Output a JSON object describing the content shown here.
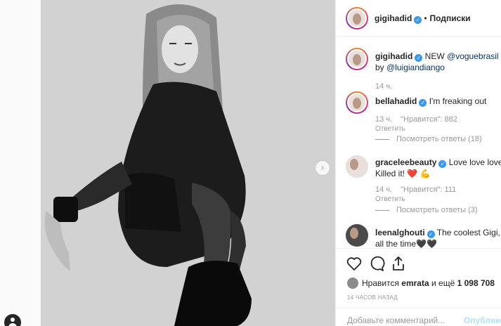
{
  "header": {
    "username": "gigihadid",
    "separator": "•",
    "follow_label": "Подписки"
  },
  "caption": {
    "username": "gigihadid",
    "text_before": "NEW ",
    "mention1": "@voguebrasil",
    "line2_prefix": "by ",
    "mention2": "@luigiandiango",
    "time": "14 ч."
  },
  "comments": [
    {
      "username": "bellahadid",
      "text": "I'm freaking out",
      "time": "13 ч.",
      "likes": "\"Нравится\": 882",
      "reply": "Ответить",
      "view_replies": "Посмотреть ответы (18)"
    },
    {
      "username": "graceleebeauty",
      "text": "Love love love.",
      "text_line2": "Killed it! ❤️ 💪",
      "time": "14 ч.",
      "likes": "\"Нравится\": 111",
      "reply": "Ответить",
      "view_replies": "Посмотреть ответы (3)"
    },
    {
      "username": "leenalghouti",
      "text": "The coolest Gigi,",
      "text_line2": "all the time🖤🖤"
    }
  ],
  "likes_line": {
    "prefix": "Нравится ",
    "user": "emrata",
    "middle": " и ещё ",
    "count": "1 098 708"
  },
  "time_ago": "14 ЧАСОВ НАЗАД",
  "add_comment": {
    "placeholder": "Добавьте комментарий...",
    "publish_label": "Опублико"
  },
  "icons": {
    "verified": "verified-badge-icon",
    "heart": "heart-icon",
    "comment": "comment-icon",
    "share": "share-icon",
    "next": "chevron-right-icon",
    "profile": "user-icon"
  },
  "colors": {
    "verified": "#3897f0",
    "link": "#003569",
    "muted": "#999999",
    "publish": "#b2dffc"
  }
}
